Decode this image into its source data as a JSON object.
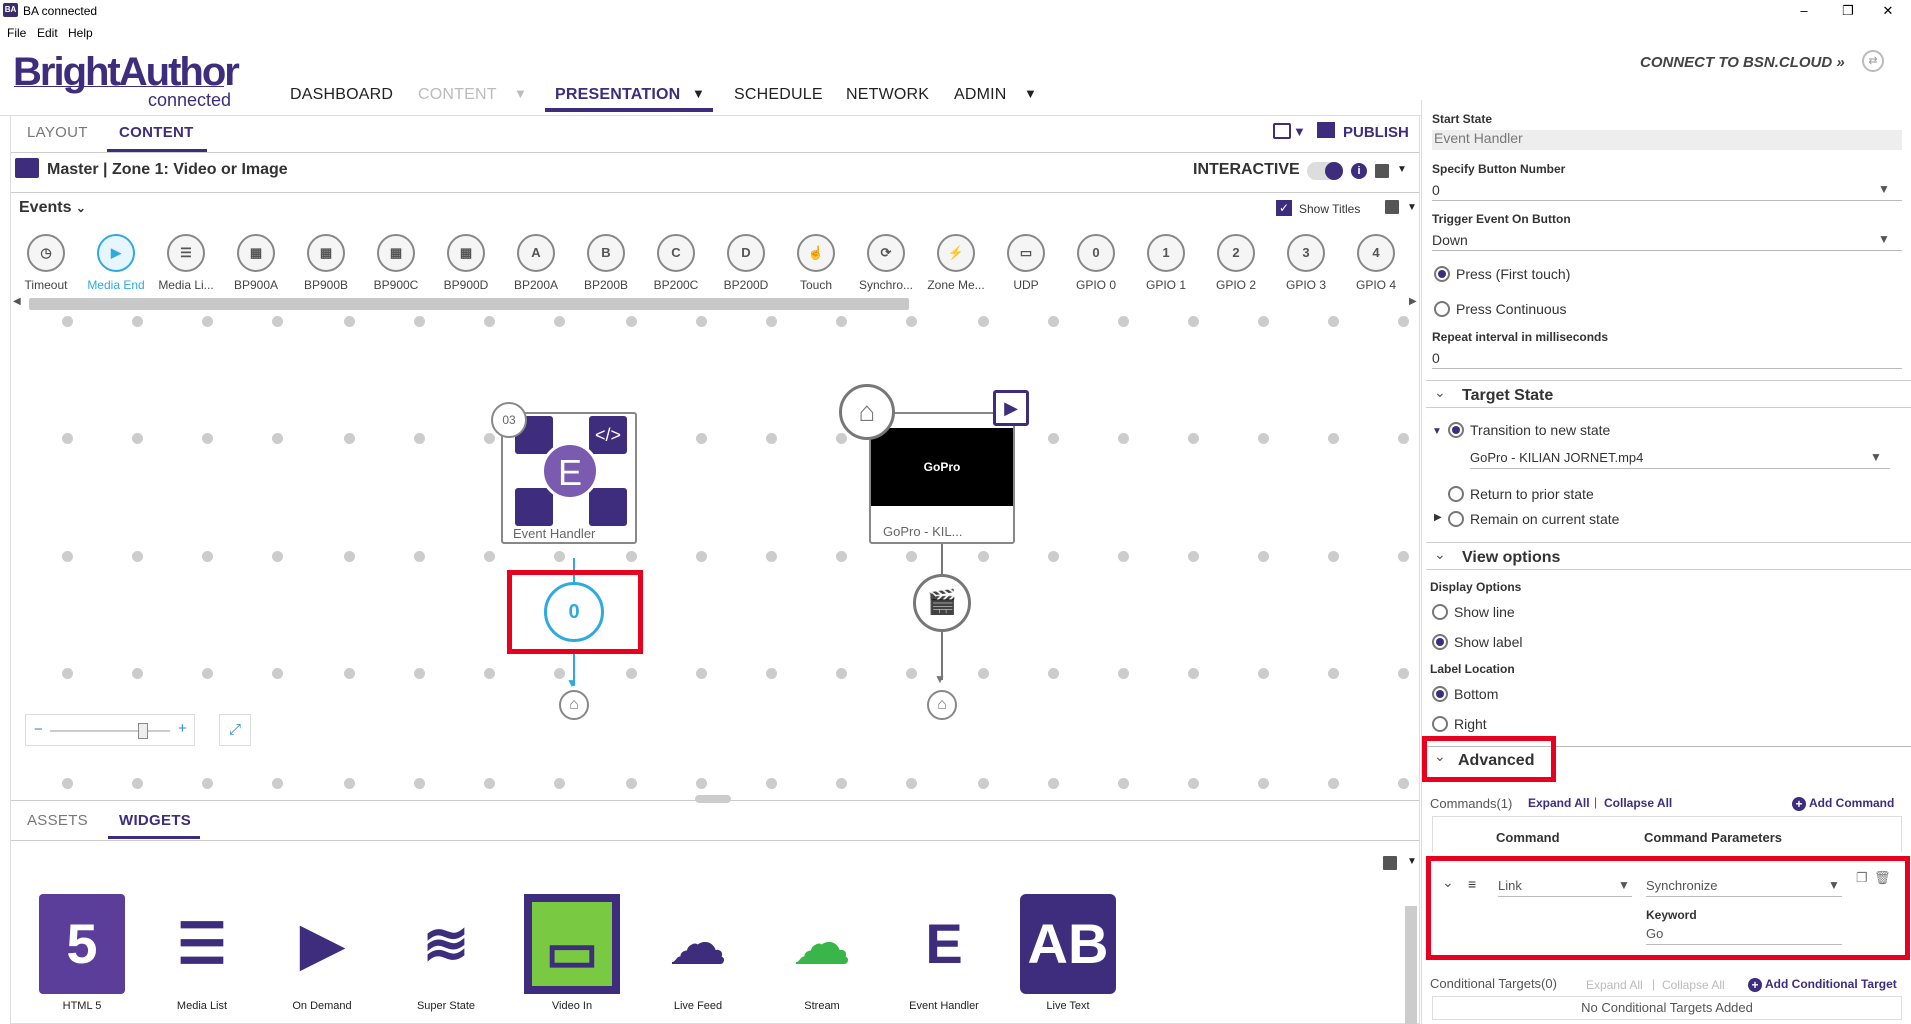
{
  "window": {
    "title": "BA connected",
    "min": "–",
    "max": "❐",
    "close": "✕"
  },
  "menu": [
    "File",
    "Edit",
    "Help"
  ],
  "brand": {
    "name": "BrightAuthor",
    "sub": "connected"
  },
  "nav": {
    "dashboard": "DASHBOARD",
    "content": "CONTENT",
    "presentation": "PRESENTATION",
    "schedule": "SCHEDULE",
    "network": "NETWORK",
    "admin": "ADMIN"
  },
  "bsn": "CONNECT TO BSN.CLOUD »",
  "editor": {
    "tabs": [
      "LAYOUT",
      "CONTENT"
    ],
    "publish": "PUBLISH",
    "zone": "Master | Zone 1: Video or Image",
    "interactive": "INTERACTIVE",
    "events_label": "Events",
    "show_titles": "Show Titles"
  },
  "events": [
    {
      "label": "Timeout",
      "glyph": "◷"
    },
    {
      "label": "Media End",
      "glyph": "▶"
    },
    {
      "label": "Media Li...",
      "glyph": "☰"
    },
    {
      "label": "BP900A",
      "glyph": "▦"
    },
    {
      "label": "BP900B",
      "glyph": "▦"
    },
    {
      "label": "BP900C",
      "glyph": "▦"
    },
    {
      "label": "BP900D",
      "glyph": "▦"
    },
    {
      "label": "BP200A",
      "glyph": "A"
    },
    {
      "label": "BP200B",
      "glyph": "B"
    },
    {
      "label": "BP200C",
      "glyph": "C"
    },
    {
      "label": "BP200D",
      "glyph": "D"
    },
    {
      "label": "Touch",
      "glyph": "☝"
    },
    {
      "label": "Synchro...",
      "glyph": "⟳"
    },
    {
      "label": "Zone Me...",
      "glyph": "⚡"
    },
    {
      "label": "UDP",
      "glyph": "▭"
    },
    {
      "label": "GPIO 0",
      "glyph": "0"
    },
    {
      "label": "GPIO 1",
      "glyph": "1"
    },
    {
      "label": "GPIO 2",
      "glyph": "2"
    },
    {
      "label": "GPIO 3",
      "glyph": "3"
    },
    {
      "label": "GPIO 4",
      "glyph": "4"
    }
  ],
  "canvas": {
    "node1": {
      "badge": "03",
      "label": "Event Handler",
      "e": "E",
      "code": "</>"
    },
    "node2": {
      "label": "GoPro - KIL...",
      "thumb": "GoPro"
    },
    "button_event": "0",
    "clapper": "🎬"
  },
  "zoom": {
    "minus": "−",
    "plus": "+"
  },
  "bottom": {
    "tabs": [
      "ASSETS",
      "WIDGETS"
    ]
  },
  "widgets": [
    {
      "label": "HTML 5",
      "glyph": "5"
    },
    {
      "label": "Media List",
      "glyph": "☰"
    },
    {
      "label": "On Demand",
      "glyph": "▶"
    },
    {
      "label": "Super State",
      "glyph": "≋"
    },
    {
      "label": "Video In",
      "glyph": "▭"
    },
    {
      "label": "Live Feed",
      "glyph": "☁"
    },
    {
      "label": "Stream",
      "glyph": "☁"
    },
    {
      "label": "Event Handler",
      "glyph": "E"
    },
    {
      "label": "Live Text",
      "glyph": "AB"
    }
  ],
  "props": {
    "start_state_label": "Start State",
    "start_state": "Event Handler",
    "button_number_label": "Specify Button Number",
    "button_number": "0",
    "trigger_label": "Trigger Event On Button",
    "trigger": "Down",
    "press_first": "Press (First touch)",
    "press_continuous": "Press Continuous",
    "repeat_label": "Repeat interval in milliseconds",
    "repeat": "0",
    "target_state": "Target State",
    "transition": "Transition to new state",
    "target_file": "GoPro - KILIAN JORNET.mp4",
    "return_prior": "Return to prior state",
    "remain": "Remain on current state",
    "view_options": "View options",
    "display_options": "Display Options",
    "show_line": "Show line",
    "show_label": "Show label",
    "label_location": "Label Location",
    "bottom": "Bottom",
    "right": "Right",
    "advanced": "Advanced",
    "commands": "Commands(1)",
    "expand_all": "Expand All",
    "collapse_all": "Collapse All",
    "add_command": "Add Command",
    "col_command": "Command",
    "col_params": "Command Parameters",
    "cmd_type": "Link",
    "cmd_param": "Synchronize",
    "keyword_label": "Keyword",
    "keyword": "Go",
    "cond_targets": "Conditional Targets(0)",
    "cond_expand": "Expand All",
    "cond_collapse": "Collapse All",
    "add_cond": "Add Conditional Target",
    "no_cond": "No Conditional Targets Added"
  }
}
